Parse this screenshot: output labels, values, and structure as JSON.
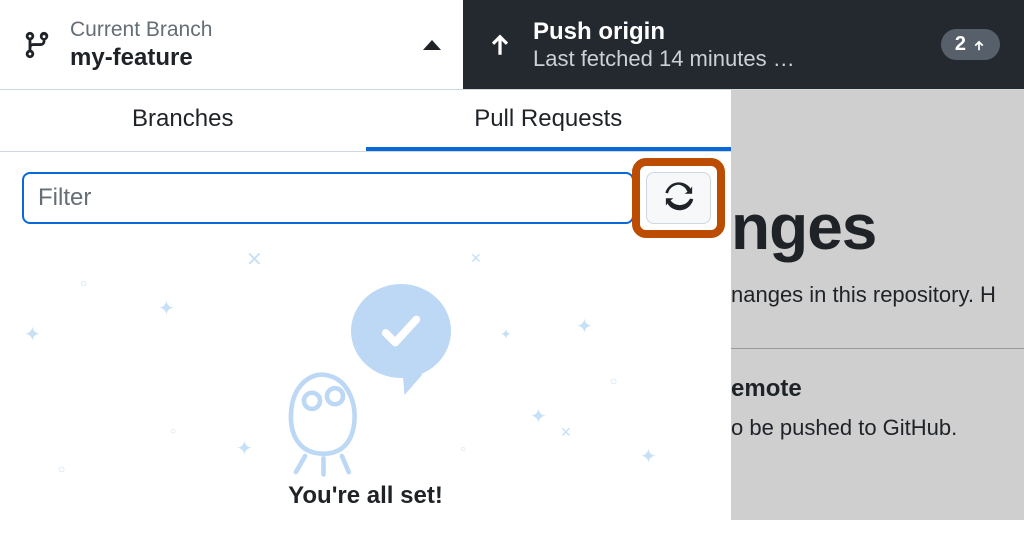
{
  "toolbar": {
    "branch_label": "Current Branch",
    "branch_name": "my-feature",
    "push_title": "Push origin",
    "push_sub": "Last fetched 14 minutes …",
    "badge_count": "2"
  },
  "tabs": {
    "branches": "Branches",
    "pull_requests": "Pull Requests"
  },
  "filter": {
    "placeholder": "Filter"
  },
  "empty": {
    "heading": "You're all set!"
  },
  "background": {
    "heading_fragment": "nges",
    "sub_fragment": "nanges in this repository. H",
    "section_title_fragment": "emote",
    "section_body_fragment": "o be pushed to GitHub."
  }
}
